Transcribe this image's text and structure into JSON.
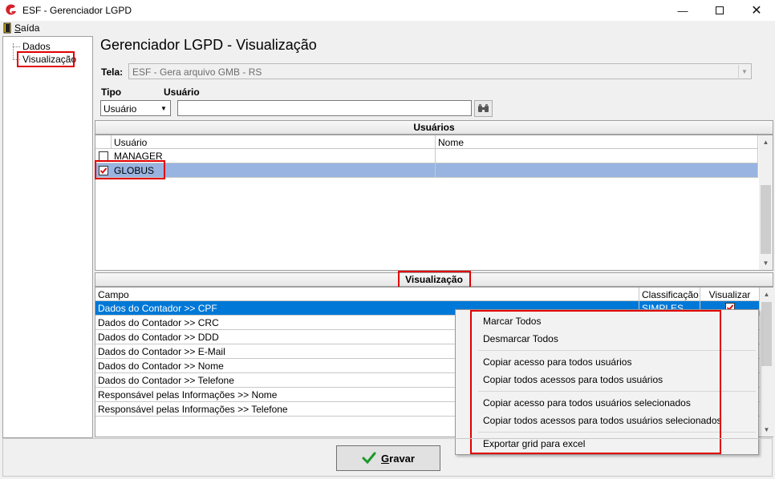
{
  "window": {
    "title": "ESF - Gerenciador LGPD"
  },
  "menu": {
    "exit_label": "Saída"
  },
  "tree": {
    "items": [
      {
        "label": "Dados"
      },
      {
        "label": "Visualização"
      }
    ]
  },
  "header": {
    "title": "Gerenciador LGPD - Visualização",
    "tela_label": "Tela:",
    "tela_value": "ESF - Gera arquivo GMB - RS",
    "tipo_label": "Tipo",
    "tipo_value": "Usuário",
    "usuario_label": "Usuário",
    "usuario_value": ""
  },
  "users_panel": {
    "title": "Usuários",
    "columns": [
      "Usuário",
      "Nome"
    ],
    "rows": [
      {
        "checked": false,
        "usuario": "MANAGER",
        "nome": ""
      },
      {
        "checked": true,
        "usuario": "GLOBUS",
        "nome": ""
      }
    ]
  },
  "view_panel": {
    "title": "Visualização",
    "columns": [
      "Campo",
      "Classificação",
      "Visualizar"
    ],
    "rows": [
      {
        "campo": "Dados do Contador >> CPF",
        "classificacao": "SIMPLES",
        "visualizar": true
      },
      {
        "campo": "Dados do Contador >> CRC",
        "classificacao": "",
        "visualizar": false
      },
      {
        "campo": "Dados do Contador >> DDD",
        "classificacao": "",
        "visualizar": false
      },
      {
        "campo": "Dados do Contador >> E-Mail",
        "classificacao": "",
        "visualizar": false
      },
      {
        "campo": "Dados do Contador >> Nome",
        "classificacao": "",
        "visualizar": false
      },
      {
        "campo": "Dados do Contador >> Telefone",
        "classificacao": "",
        "visualizar": false
      },
      {
        "campo": "Responsável pelas Informações >> Nome",
        "classificacao": "",
        "visualizar": false
      },
      {
        "campo": "Responsável pelas Informações >> Telefone",
        "classificacao": "",
        "visualizar": false
      }
    ]
  },
  "context_menu": {
    "items": [
      "Marcar Todos",
      "Desmarcar Todos",
      "Copiar acesso para todos usuários",
      "Copiar todos acessos para todos usuários",
      "Copiar acesso para todos usuários selecionados",
      "Copiar todos acessos para todos usuários selecionados",
      "Exportar grid para excel"
    ]
  },
  "footer": {
    "save_label": "Gravar"
  },
  "colors": {
    "selection": "#0078d7",
    "row_highlight": "#99b4e1",
    "highlight_box": "#e00000",
    "logo": "#d42027"
  }
}
